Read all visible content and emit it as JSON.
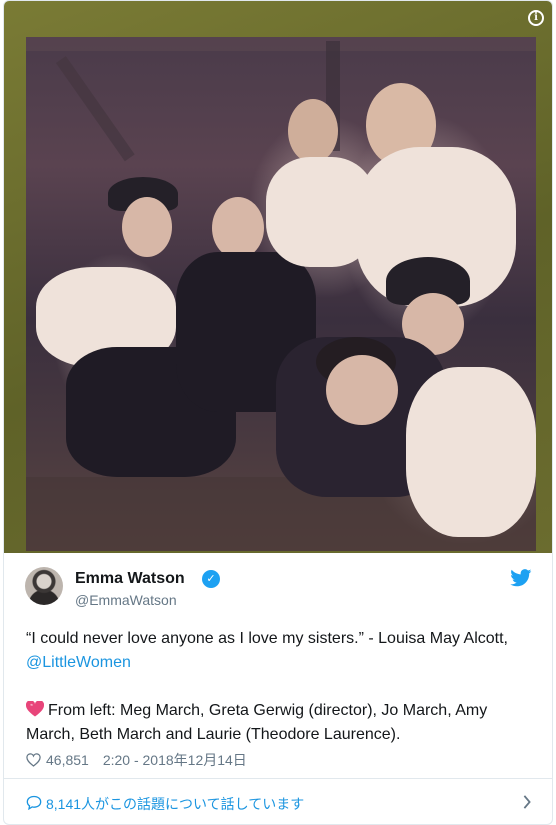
{
  "media": {
    "info_icon": "info-icon",
    "info_symbol": "i"
  },
  "author": {
    "name": "Emma Watson",
    "handle": "@EmmaWatson",
    "verified_icon": "verified-check-icon",
    "verified_symbol": "✓"
  },
  "tweet": {
    "quote_text": "“I could never love anyone as I love my sisters.” - Louisa May Alcott, ",
    "quote_link": "@LittleWomen",
    "emoji": "heart-emoji",
    "body_text": "From left: Meg March, Greta Gerwig (director), Jo March, Amy March, Beth March and Laurie (Theodore Laurence).",
    "like_count": "46,851",
    "timestamp": "2:20 - 2018年12月14日"
  },
  "footer": {
    "talk_label": "8,141人がこの話題について話しています"
  },
  "colors": {
    "link": "#1b95e0",
    "twitter_blue": "#1da1f2",
    "muted": "#657786",
    "text": "#14171a",
    "border": "#e1e8ed"
  }
}
